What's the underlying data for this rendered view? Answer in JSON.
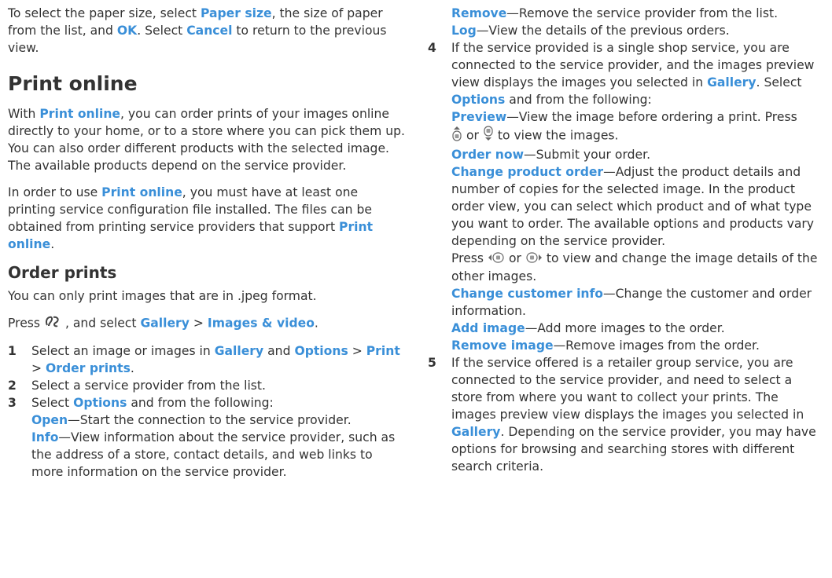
{
  "intro": {
    "t1": "To select the paper size, select ",
    "k1": "Paper size",
    "t2": ", the size of paper from the list, and ",
    "k2": "OK",
    "t3": ". Select ",
    "k3": "Cancel",
    "t4": " to return to the previous view."
  },
  "heading": "Print online",
  "para1": {
    "t1": "With ",
    "k1": "Print online",
    "t2": ", you can order prints of your images online directly to your home, or to a store where you can pick them up. You can also order different products with the selected image. The available products depend on the service provider."
  },
  "para2": {
    "t1": "In order to use ",
    "k1": "Print online",
    "t2": ", you must have at least one printing service configuration file installed. The files can be obtained from printing service providers that support ",
    "k2": "Print online",
    "t3": "."
  },
  "subheading": "Order prints",
  "para3": "You can only print images that are in .jpeg format.",
  "press": {
    "t1": "Press ",
    "t2": " , and select ",
    "k1": "Gallery",
    "sep": " > ",
    "k2": "Images & video",
    "t3": "."
  },
  "steps": {
    "s1": {
      "num": "1",
      "t1": "Select an image or images in ",
      "k1": "Gallery",
      "t2": " and ",
      "k2": "Options",
      "sep1": " > ",
      "k3": "Print",
      "sep2": " > ",
      "k4": "Order prints",
      "t3": "."
    },
    "s2": {
      "num": "2",
      "text": "Select a service provider from the list."
    },
    "s3": {
      "num": "3",
      "t1": "Select ",
      "k1": "Options",
      "t2": " and from the following:",
      "open_k": "Open",
      "open_t": "—Start the connection to the service provider.",
      "info_k": "Info",
      "info_t": "—View information about the service provider, such as the address of a store, contact details, and web links to more information on the service provider.",
      "remove_k": "Remove",
      "remove_t": "—Remove the service provider from the list.",
      "log_k": "Log",
      "log_t": "—View the details of the previous orders."
    },
    "s4": {
      "num": "4",
      "t1": "If the service provided is a single shop service, you are connected to the service provider, and the images preview view displays the images you selected in ",
      "k1": "Gallery",
      "t2": ". Select ",
      "k2": "Options",
      "t3": " and from the following:",
      "preview_k": "Preview",
      "preview_t": "—View the image before ordering a print. Press ",
      "or1": " or ",
      "preview_t2": " to view the images.",
      "ordernow_k": "Order now",
      "ordernow_t": "—Submit your order.",
      "cpo_k": "Change product order",
      "cpo_t": "—Adjust the product details and number of copies for the selected image. In the product order view, you can select which product and of what type you want to order. The available options and products vary depending on the service provider.",
      "press2": "Press ",
      "or2": " or ",
      "press2_t": " to view and change the image details of the other images.",
      "cci_k": "Change customer info",
      "cci_t": "—Change the customer and order information.",
      "add_k": "Add image",
      "add_t": "—Add more images to the order.",
      "rem_k": "Remove image",
      "rem_t": "—Remove images from the order."
    },
    "s5": {
      "num": "5",
      "t1": "If the service offered is a retailer group service, you are connected to the service provider, and need to select a store from where you want to collect your prints. The images preview view displays the images you selected in ",
      "k1": "Gallery",
      "t2": ". Depending on the service provider, you may have options for browsing and searching stores with different search criteria."
    }
  },
  "icons": {
    "menu_key": "menu-key-icon",
    "scroll_up": "scroll-up-key-icon",
    "scroll_down": "scroll-down-key-icon",
    "scroll_left": "scroll-left-key-icon",
    "scroll_right": "scroll-right-key-icon"
  },
  "colors": {
    "text": "#333333",
    "keyword": "#3a8fd8"
  }
}
